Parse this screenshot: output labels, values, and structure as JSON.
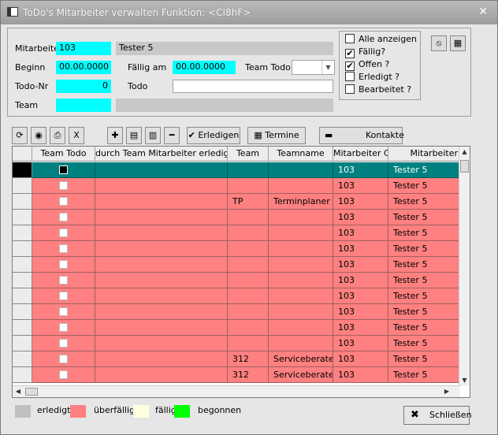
{
  "window": {
    "title": "ToDo's Mitarbeiter verwalten   Funktion: <CI8hF>",
    "close": "✕"
  },
  "form": {
    "mitarbeiter_label": "Mitarbeiter",
    "mitarbeiter_value": "103",
    "mitarbeiter_name": "Tester 5",
    "beginn_label": "Beginn",
    "beginn_value": "00.00.0000",
    "faellig_label": "Fällig am",
    "faellig_value": "00.00.0000",
    "team_todo_label": "Team Todo",
    "team_todo_value": "",
    "todo_nr_label": "Todo-Nr",
    "todo_nr_value": "0",
    "todo_label": "Todo",
    "todo_value": "",
    "team_label": "Team",
    "team_value": "",
    "team_name": ""
  },
  "filters": [
    {
      "label": "Alle anzeigen",
      "checked": false
    },
    {
      "label": "Fällig?",
      "checked": true
    },
    {
      "label": "Offen ?",
      "checked": true
    },
    {
      "label": "Erledigt ?",
      "checked": false
    },
    {
      "label": "Bearbeitet ?",
      "checked": false
    }
  ],
  "toolbar": {
    "erledigen": "Erledigen",
    "termine": "Termine",
    "kontakte": "Kontakte"
  },
  "grid": {
    "columns": [
      "Team Todo",
      "durch Team Mitarbeiter erledigt",
      "Team",
      "Teamname",
      "Mitarbeiter Cd",
      "Mitarbeiter"
    ],
    "rows": [
      {
        "team": "",
        "teamname": "",
        "code": "103",
        "name": "Tester 5",
        "selected": true
      },
      {
        "team": "",
        "teamname": "",
        "code": "103",
        "name": "Tester 5"
      },
      {
        "team": "TP",
        "teamname": "Terminplaner T",
        "code": "103",
        "name": "Tester 5"
      },
      {
        "team": "",
        "teamname": "",
        "code": "103",
        "name": "Tester 5"
      },
      {
        "team": "",
        "teamname": "",
        "code": "103",
        "name": "Tester 5"
      },
      {
        "team": "",
        "teamname": "",
        "code": "103",
        "name": "Tester 5"
      },
      {
        "team": "",
        "teamname": "",
        "code": "103",
        "name": "Tester 5"
      },
      {
        "team": "",
        "teamname": "",
        "code": "103",
        "name": "Tester 5"
      },
      {
        "team": "",
        "teamname": "",
        "code": "103",
        "name": "Tester 5"
      },
      {
        "team": "",
        "teamname": "",
        "code": "103",
        "name": "Tester 5"
      },
      {
        "team": "",
        "teamname": "",
        "code": "103",
        "name": "Tester 5"
      },
      {
        "team": "",
        "teamname": "",
        "code": "103",
        "name": "Tester 5"
      },
      {
        "team": "312",
        "teamname": "Serviceberater",
        "code": "103",
        "name": "Tester 5"
      },
      {
        "team": "312",
        "teamname": "Serviceberater",
        "code": "103",
        "name": "Tester 5"
      }
    ]
  },
  "legend": [
    {
      "label": "erledigt",
      "color": "#c0c0c0"
    },
    {
      "label": "überfällig",
      "color": "#ff8080"
    },
    {
      "label": "fällig",
      "color": "#ffffe0"
    },
    {
      "label": "begonnen",
      "color": "#00ff00"
    }
  ],
  "colors": {
    "row": "#ff8080",
    "selected_row": "#008080",
    "field": "#00ffff"
  },
  "close_button": "Schließen"
}
